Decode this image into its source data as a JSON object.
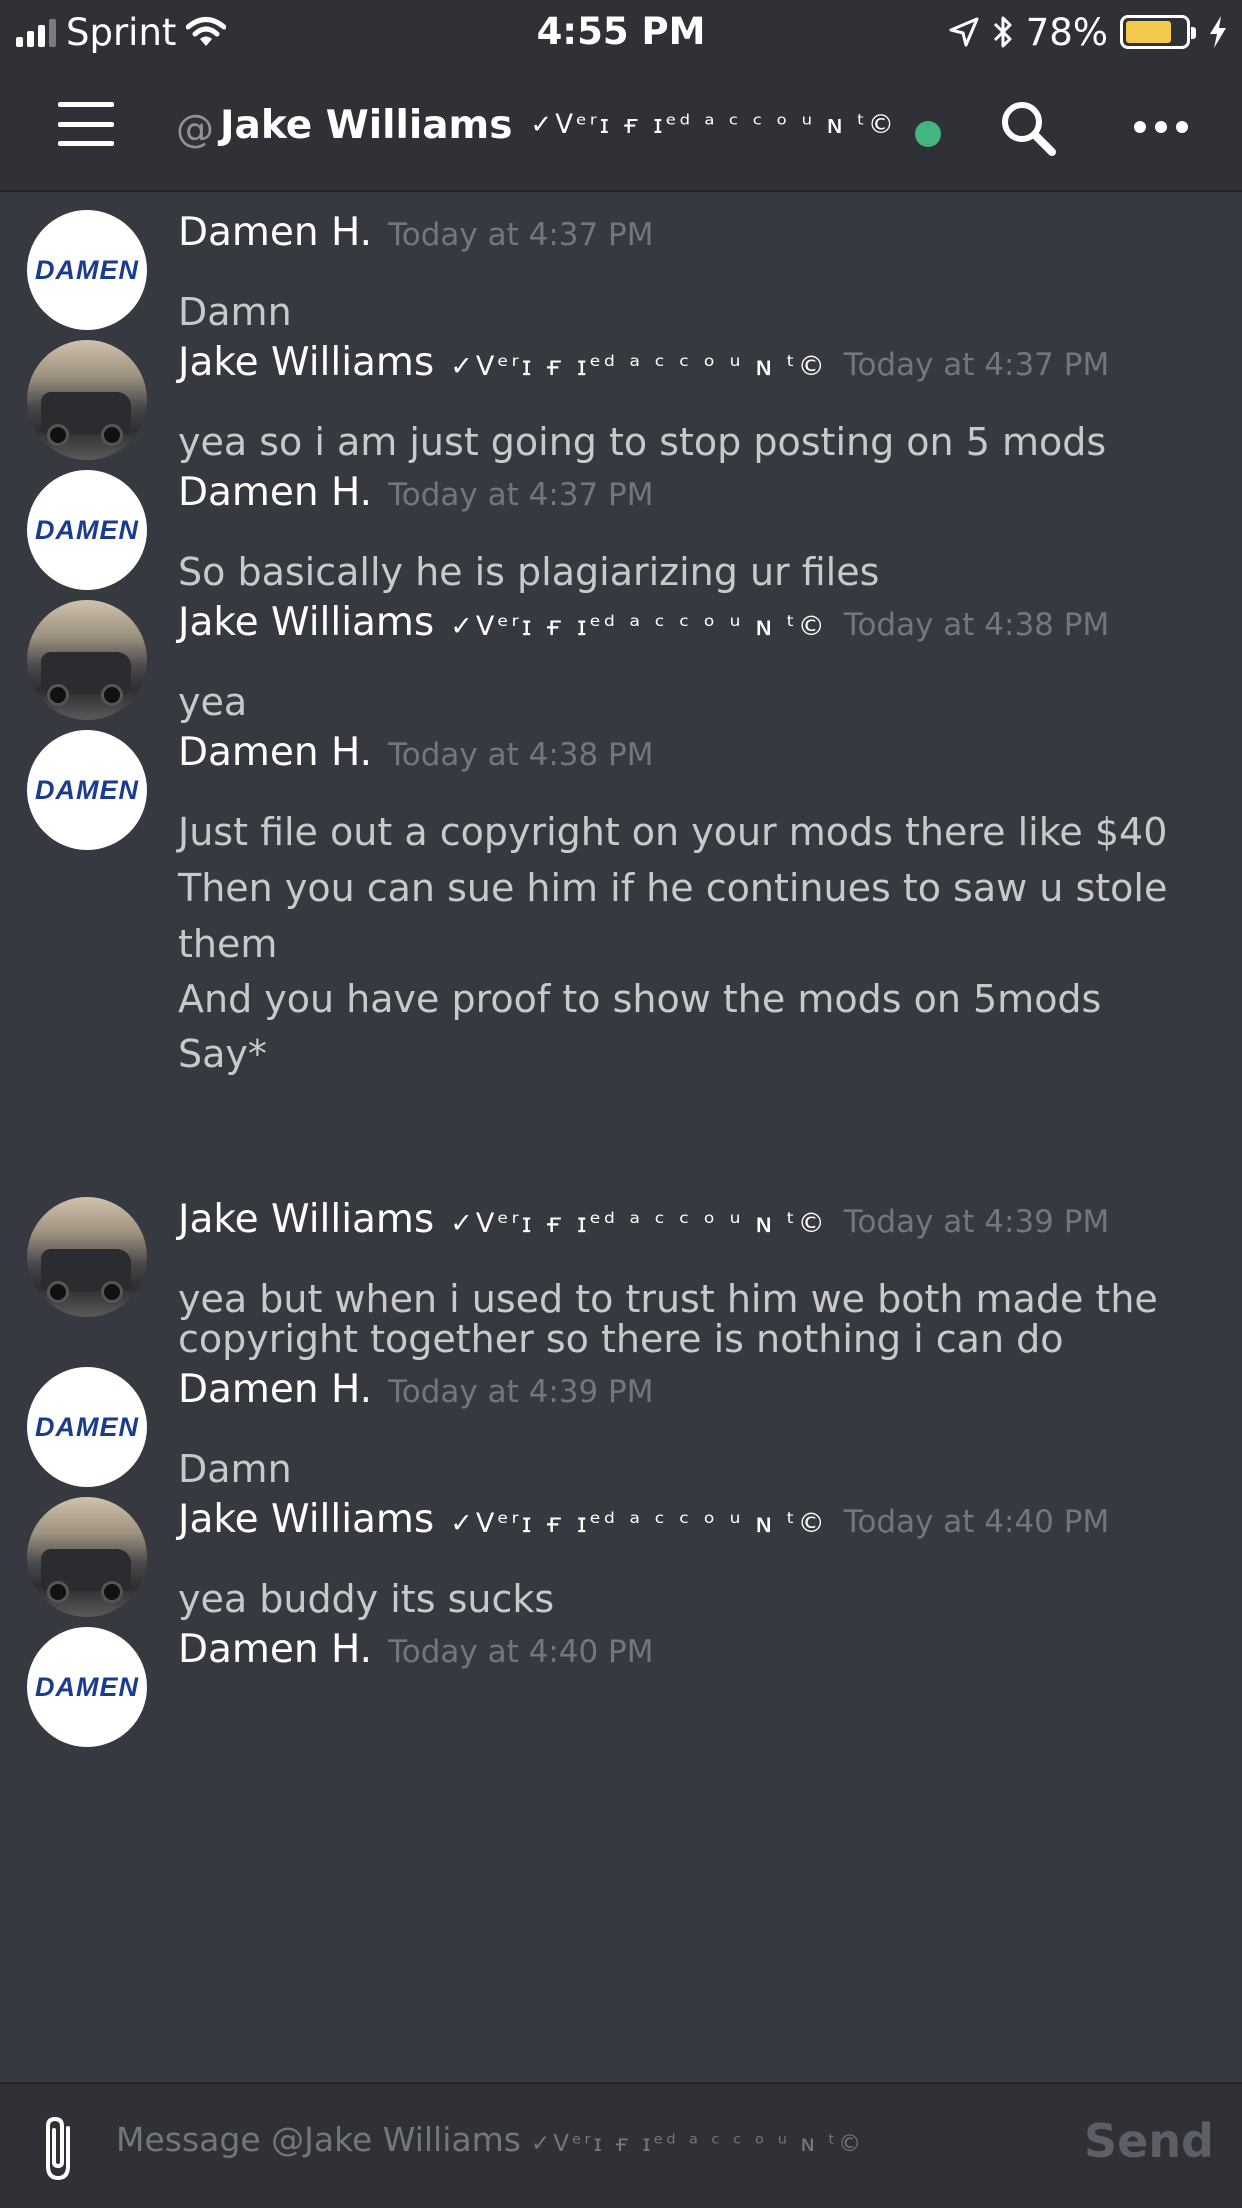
{
  "status_bar": {
    "carrier": "Sprint",
    "time": "4:55 PM",
    "battery_percent": "78%",
    "battery_level": 0.78,
    "battery_color": "#f2c94c",
    "icons": [
      "signal-icon",
      "wifi-icon",
      "location-arrow-icon",
      "bluetooth-icon",
      "battery-icon",
      "charging-bolt-icon"
    ]
  },
  "header": {
    "at_symbol": "@",
    "name": "Jake Williams",
    "verified_text": "✓ᐯᵉʳɪ ғ ɪᵉᵈ ᵃ ᶜ ᶜ ᵒ ᵘ ɴ ᵗ©",
    "online": true,
    "online_color": "#43b581",
    "icons": [
      "menu-icon",
      "search-icon",
      "more-icon"
    ]
  },
  "messages": [
    {
      "author": "Damen H.",
      "verified": "",
      "avatar": "DAMEN",
      "timestamp": "Today at 4:37 PM",
      "lines": [
        "Damn"
      ]
    },
    {
      "author": "Jake Williams",
      "verified": "✓ᐯᵉʳɪ ғ ɪᵉᵈ ᵃ ᶜ ᶜ ᵒ ᵘ ɴ ᵗ©",
      "avatar": "",
      "timestamp": "Today at 4:37 PM",
      "lines": [
        "yea so i am just going to stop posting on 5 mods"
      ]
    },
    {
      "author": "Damen H.",
      "verified": "",
      "avatar": "DAMEN",
      "timestamp": "Today at 4:37 PM",
      "lines": [
        "So basically he is plagiarizing ur files"
      ]
    },
    {
      "author": "Jake Williams",
      "verified": "✓ᐯᵉʳɪ ғ ɪᵉᵈ ᵃ ᶜ ᶜ ᵒ ᵘ ɴ ᵗ©",
      "avatar": "",
      "timestamp": "Today at 4:38 PM",
      "lines": [
        "yea"
      ]
    },
    {
      "author": "Damen H.",
      "verified": "",
      "avatar": "DAMEN",
      "timestamp": "Today at 4:38 PM",
      "lines": [
        "Just file out a copyright on your mods there like $40",
        "Then you can sue him if he continues to saw u stole",
        "them",
        "And you have proof to show the mods on 5mods",
        "Say*"
      ]
    },
    {
      "author": "Jake Williams",
      "verified": "✓ᐯᵉʳɪ ғ ɪᵉᵈ ᵃ ᶜ ᶜ ᵒ ᵘ ɴ ᵗ©",
      "avatar": "",
      "timestamp": "Today at 4:39 PM",
      "lines": [
        "yea but when i used to trust him we both made the",
        "copyright together so there is nothing i can do"
      ]
    },
    {
      "author": "Damen H.",
      "verified": "",
      "avatar": "DAMEN",
      "timestamp": "Today at 4:39 PM",
      "lines": [
        "Damn"
      ]
    },
    {
      "author": "Jake Williams",
      "verified": "✓ᐯᵉʳɪ ғ ɪᵉᵈ ᵃ ᶜ ᶜ ᵒ ᵘ ɴ ᵗ©",
      "avatar": "",
      "timestamp": "Today at 4:40 PM",
      "lines": [
        "yea buddy its sucks"
      ]
    },
    {
      "author": "Damen H.",
      "verified": "",
      "avatar": "DAMEN",
      "timestamp": "Today at 4:40 PM",
      "lines": []
    }
  ],
  "input": {
    "placeholder": "Message @Jake Williams",
    "placeholder_verified": "✓ᐯᵉʳɪ ғ ɪᵉᵈ ᵃ ᶜ ᶜ ᵒ ᵘ ɴ ᵗ©",
    "send_label": "Send",
    "icons": [
      "paperclip-icon"
    ]
  }
}
